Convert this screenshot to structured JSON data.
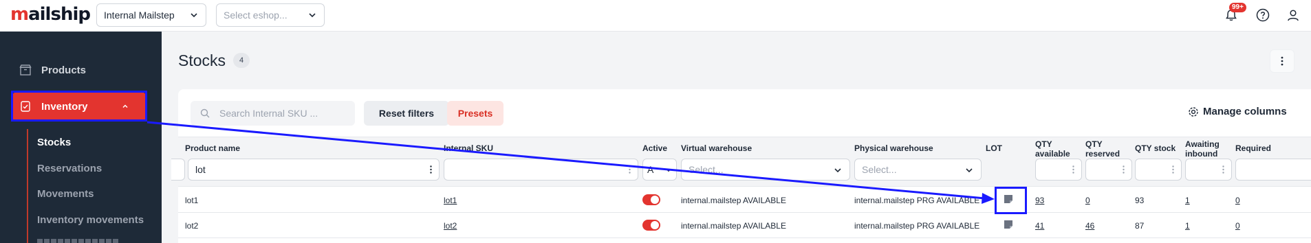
{
  "app": {
    "logo_text_accent": "m",
    "logo_text_rest": "ailship",
    "warehouse_select": "Internal Mailstep",
    "eshop_select_placeholder": "Select eshop...",
    "notification_count": "99+"
  },
  "sidebar": {
    "products_label": "Products",
    "inventory_label": "Inventory",
    "sub_items": [
      "Stocks",
      "Reservations",
      "Movements",
      "Inventory movements"
    ]
  },
  "page": {
    "title": "Stocks",
    "count": "4"
  },
  "toolbar": {
    "search_placeholder": "Search Internal SKU ...",
    "reset_label": "Reset filters",
    "presets_label": "Presets",
    "manage_columns_label": "Manage columns"
  },
  "table": {
    "headers": {
      "product_name": "Product name",
      "internal_sku": "Internal SKU",
      "active": "Active",
      "virtual_warehouse": "Virtual warehouse",
      "physical_warehouse": "Physical warehouse",
      "lot": "LOT",
      "qty_available_1": "QTY",
      "qty_available_2": "available",
      "qty_reserved_1": "QTY",
      "qty_reserved_2": "reserved",
      "qty_stock": "QTY stock",
      "awaiting_inbound_1": "Awaiting",
      "awaiting_inbound_2": "inbound",
      "required": "Required"
    },
    "filters": {
      "product_name_value": "lot",
      "active_value": "A",
      "virtual_warehouse_placeholder": "Select...",
      "physical_warehouse_placeholder": "Select..."
    },
    "rows": [
      {
        "product_name": "lot1",
        "internal_sku": "lot1",
        "active": true,
        "virtual_warehouse": "internal.mailstep AVAILABLE",
        "physical_warehouse": "internal.mailstep PRG AVAILABLE",
        "qty_available": "93",
        "qty_reserved": "0",
        "qty_stock": "93",
        "awaiting_inbound": "1",
        "required": "0"
      },
      {
        "product_name": "lot2",
        "internal_sku": "lot2",
        "active": true,
        "virtual_warehouse": "internal.mailstep AVAILABLE",
        "physical_warehouse": "internal.mailstep PRG AVAILABLE",
        "qty_available": "41",
        "qty_reserved": "46",
        "qty_stock": "87",
        "awaiting_inbound": "1",
        "required": "0"
      }
    ]
  },
  "colors": {
    "brand_red": "#e3342f",
    "sidebar_bg": "#1e2a38",
    "annotation_blue": "#1a1aff"
  }
}
